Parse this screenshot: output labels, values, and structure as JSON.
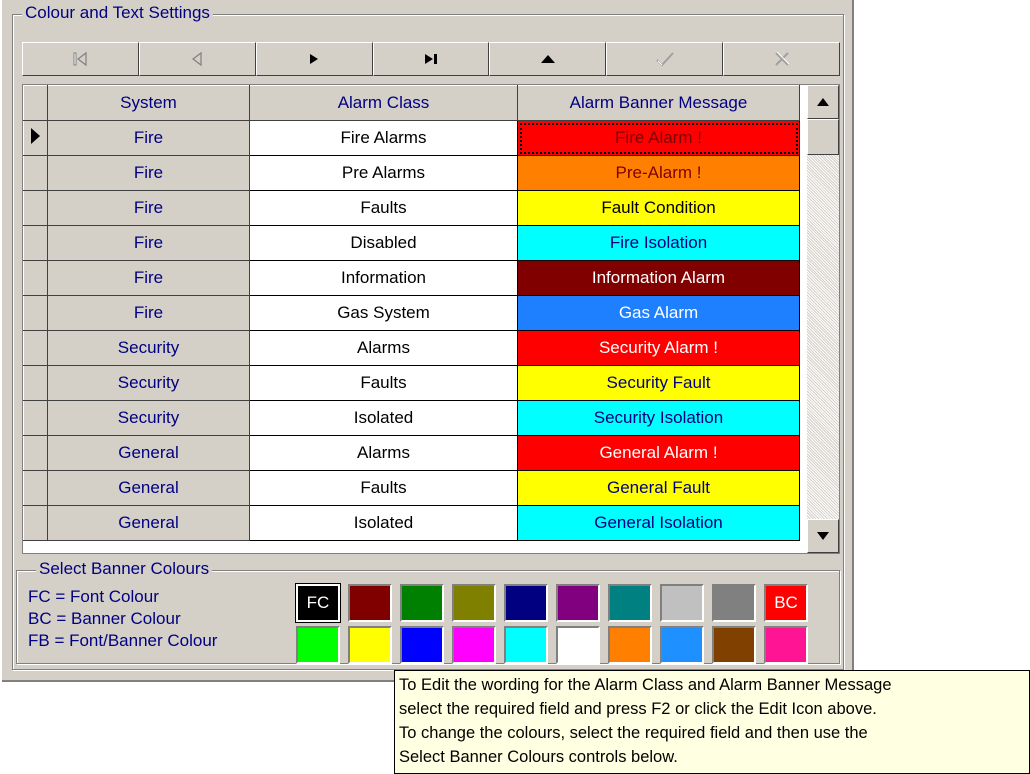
{
  "group_title": "Colour and Text Settings",
  "navigator": {
    "buttons": [
      {
        "name": "first-record-button",
        "icon": "first-icon",
        "enabled": false
      },
      {
        "name": "prior-record-button",
        "icon": "prior-icon",
        "enabled": false
      },
      {
        "name": "next-record-button",
        "icon": "next-icon",
        "enabled": true
      },
      {
        "name": "last-record-button",
        "icon": "last-icon",
        "enabled": true
      },
      {
        "name": "edit-record-button",
        "icon": "edit-up-icon",
        "enabled": true
      },
      {
        "name": "post-record-button",
        "icon": "check-icon",
        "enabled": false
      },
      {
        "name": "cancel-record-button",
        "icon": "cancel-icon",
        "enabled": false
      }
    ]
  },
  "grid": {
    "headers": [
      "System",
      "Alarm Class",
      "Alarm Banner Message"
    ],
    "rows": [
      {
        "system": "Fire",
        "class": "Fire Alarms",
        "message": "Fire Alarm !",
        "bg": "#ff0000",
        "fg": "#800000",
        "current": true
      },
      {
        "system": "Fire",
        "class": "Pre Alarms",
        "message": "Pre-Alarm !",
        "bg": "#ff8000",
        "fg": "#800000"
      },
      {
        "system": "Fire",
        "class": "Faults",
        "message": "Fault Condition",
        "bg": "#ffff00",
        "fg": "#000000"
      },
      {
        "system": "Fire",
        "class": "Disabled",
        "message": "Fire Isolation",
        "bg": "#00ffff",
        "fg": "#000080"
      },
      {
        "system": "Fire",
        "class": "Information",
        "message": "Information Alarm",
        "bg": "#800000",
        "fg": "#ffffff"
      },
      {
        "system": "Fire",
        "class": "Gas System",
        "message": "Gas Alarm",
        "bg": "#1e80ff",
        "fg": "#ffffff"
      },
      {
        "system": "Security",
        "class": "Alarms",
        "message": "Security Alarm !",
        "bg": "#ff0000",
        "fg": "#ffffff"
      },
      {
        "system": "Security",
        "class": "Faults",
        "message": "Security Fault",
        "bg": "#ffff00",
        "fg": "#000080"
      },
      {
        "system": "Security",
        "class": "Isolated",
        "message": "Security Isolation",
        "bg": "#00ffff",
        "fg": "#000080"
      },
      {
        "system": "General",
        "class": "Alarms",
        "message": "General Alarm !",
        "bg": "#ff0000",
        "fg": "#ffffff"
      },
      {
        "system": "General",
        "class": "Faults",
        "message": "General Fault",
        "bg": "#ffff00",
        "fg": "#000080"
      },
      {
        "system": "General",
        "class": "Isolated",
        "message": "General Isolation",
        "bg": "#00ffff",
        "fg": "#000080"
      }
    ]
  },
  "colours_group": {
    "title": "Select Banner Colours",
    "legend": [
      "FC = Font Colour",
      "BC = Banner Colour",
      "FB = Font/Banner Colour"
    ],
    "fc_label": "FC",
    "bc_label": "BC",
    "row1": [
      "#000000",
      "#800000",
      "#008000",
      "#808000",
      "#000080",
      "#800080",
      "#008080",
      "#c0c0c0",
      "#808080",
      "#ff0000"
    ],
    "row2": [
      "#00ff00",
      "#ffff00",
      "#0000ff",
      "#ff00ff",
      "#00ffff",
      "#ffffff",
      "#ff8000",
      "#1e90ff",
      "#804000",
      "#ff1493"
    ]
  },
  "tooltip": {
    "lines": [
      "To Edit the wording for the Alarm Class and Alarm Banner Message",
      "select the required field and press F2 or click the Edit Icon above.",
      "To change the colours, select the required field and then use the",
      "Select Banner Colours controls below."
    ]
  }
}
